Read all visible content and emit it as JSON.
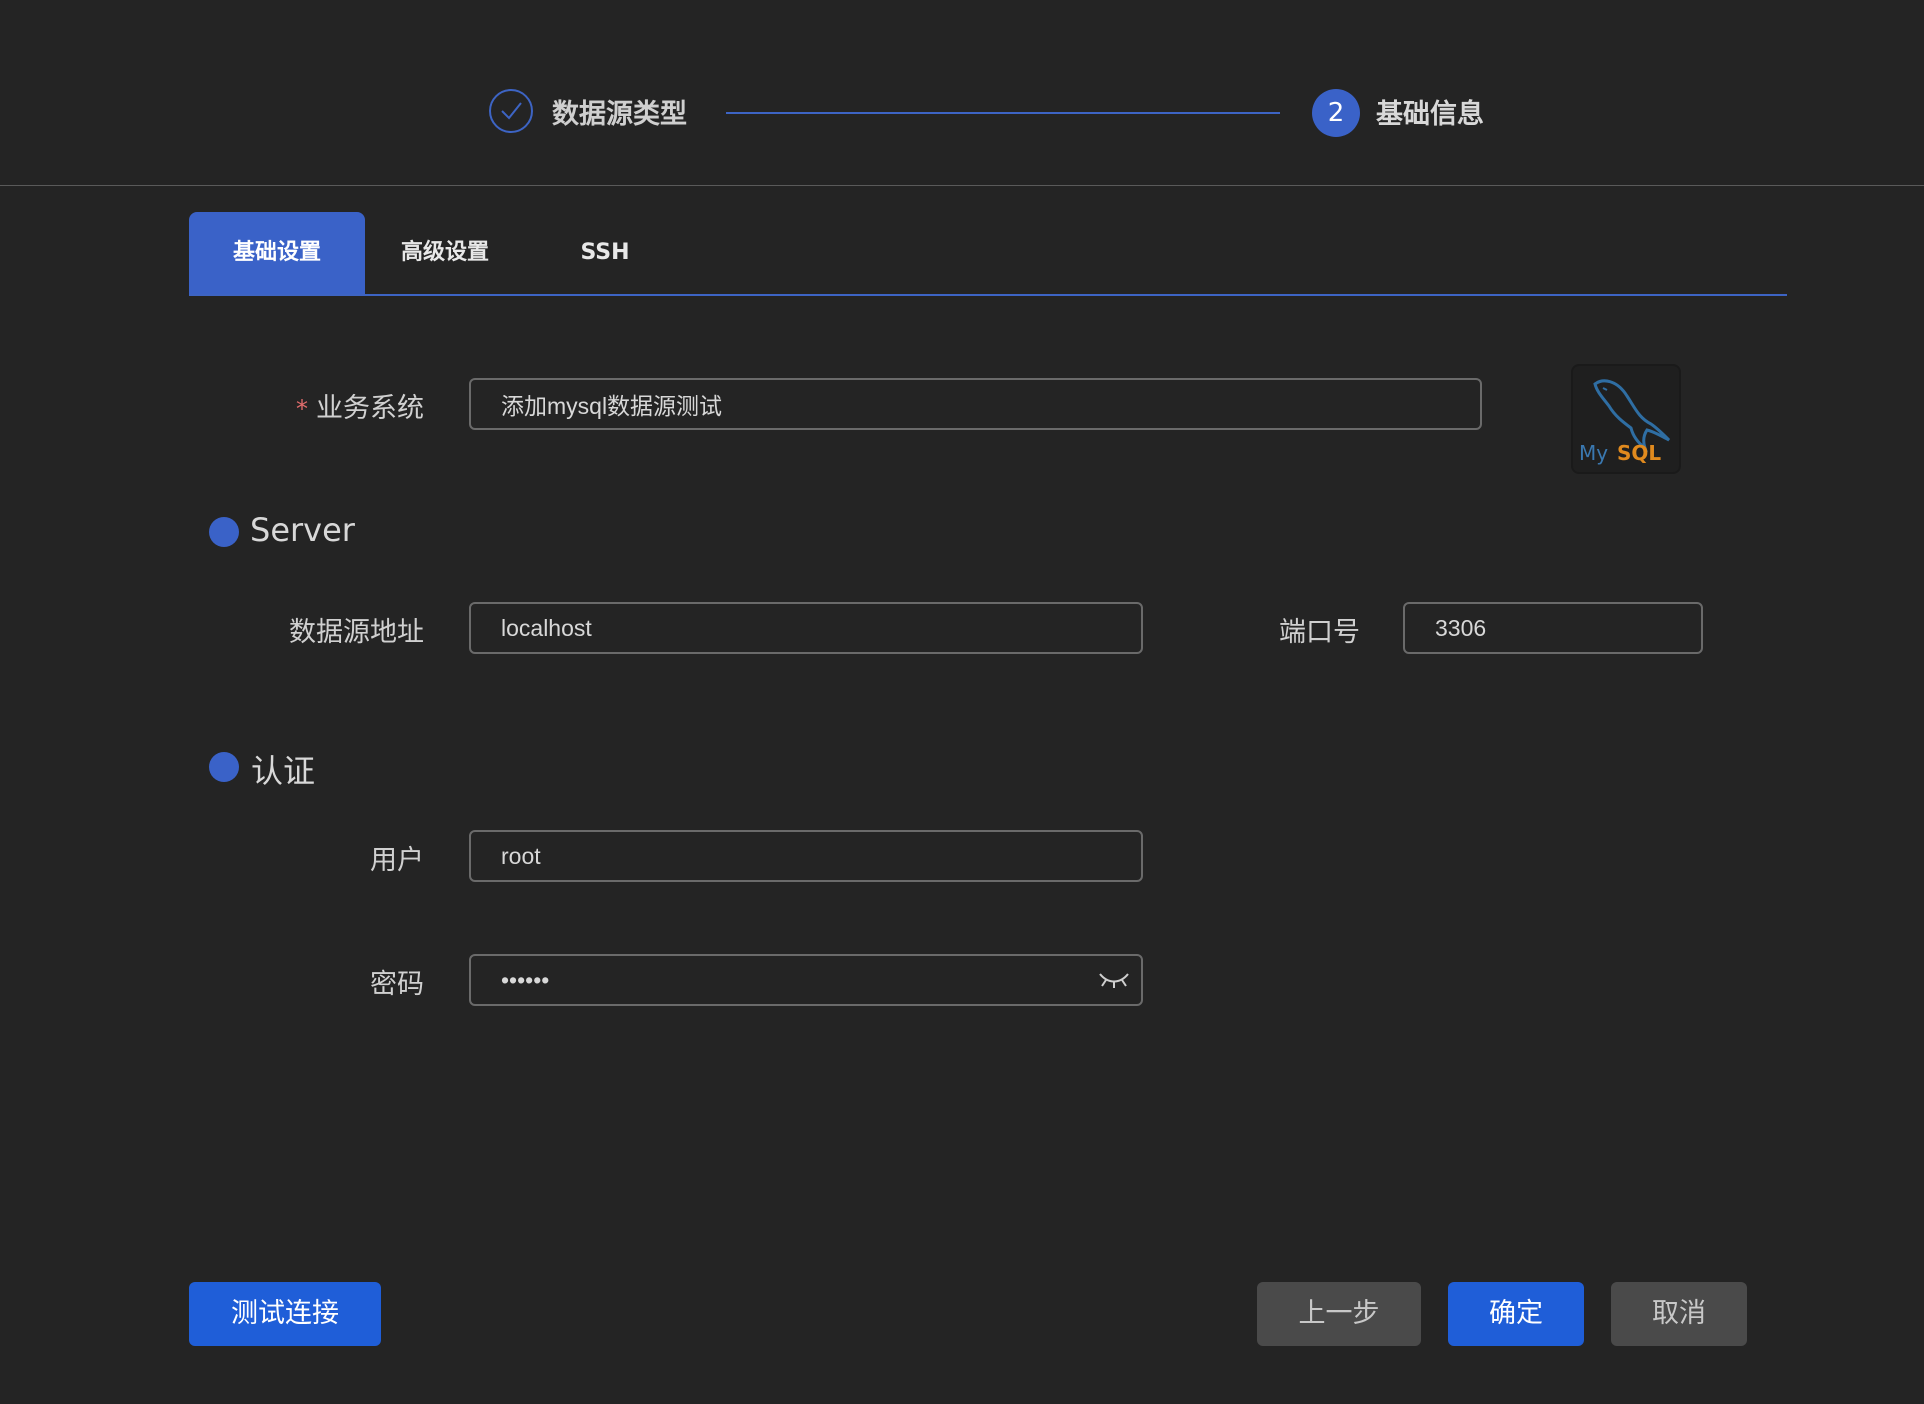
{
  "steps": {
    "step1_label": "数据源类型",
    "step2_number": "2",
    "step2_label": "基础信息"
  },
  "tabs": [
    {
      "label": "基础设置",
      "active": true
    },
    {
      "label": "高级设置",
      "active": false
    },
    {
      "label": "SSH",
      "active": false
    }
  ],
  "form": {
    "business_system": {
      "required_mark": "*",
      "label": "业务系统",
      "value": "添加mysql数据源测试"
    },
    "server_section": "Server",
    "host": {
      "label": "数据源地址",
      "value": "localhost"
    },
    "port": {
      "label": "端口号",
      "value": "3306"
    },
    "auth_section": "认证",
    "user": {
      "label": "用户",
      "value": "root"
    },
    "password": {
      "label": "密码",
      "value": "••••••"
    }
  },
  "logo": {
    "brand_text_my": "My",
    "brand_text_sql": "SQL"
  },
  "buttons": {
    "test_connection": "测试连接",
    "prev_step": "上一步",
    "confirm": "确定",
    "cancel": "取消"
  },
  "colors": {
    "accent": "#3a62c8",
    "primary_button": "#1f5ed8",
    "required": "#e06c6c",
    "background": "#242424"
  },
  "icons": {
    "step_done": "check-circle-icon",
    "password_toggle": "eye-closed-icon",
    "brand": "mysql-logo-icon"
  }
}
